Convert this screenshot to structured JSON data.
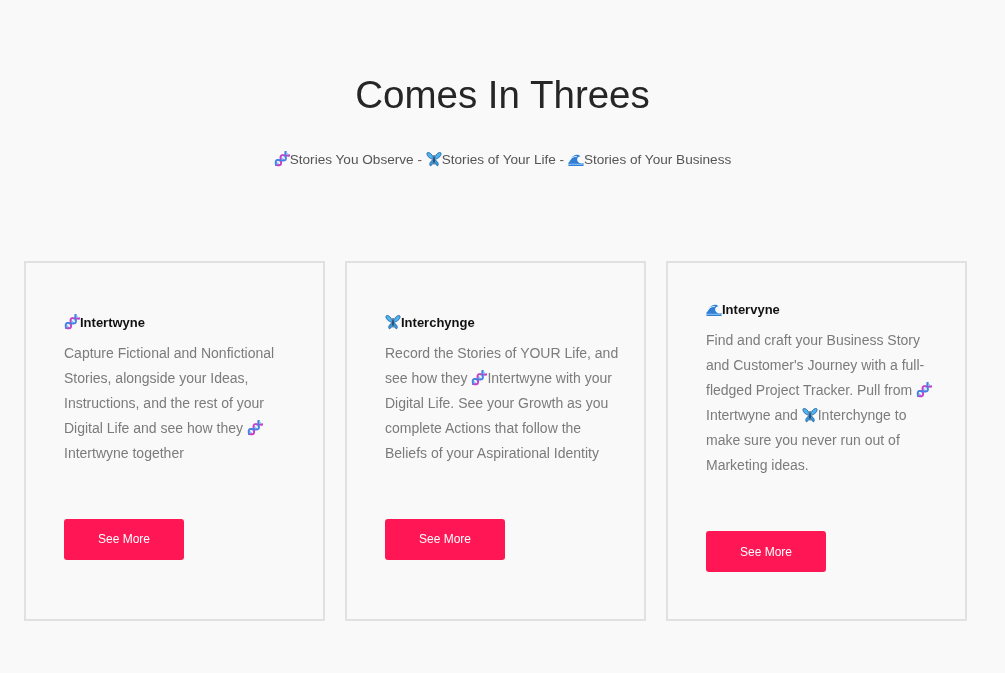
{
  "section": {
    "title": "Comes In Threes",
    "tagline": [
      {
        "kind": "dna"
      },
      {
        "kind": "text",
        "text": "Stories You Observe -"
      },
      {
        "kind": "butterfly"
      },
      {
        "kind": "text",
        "text": "Stories of Your Life -"
      },
      {
        "kind": "wave"
      },
      {
        "kind": "text",
        "text": "Stories of Your Business"
      }
    ]
  },
  "cards": [
    {
      "heading": [
        {
          "kind": "dna"
        },
        {
          "kind": "text",
          "text": "Intertwyne"
        }
      ],
      "description": [
        {
          "kind": "text",
          "text": "Capture Fictional and Nonfictional Stories, alongside your Ideas, Instructions, and the rest of your Digital Life and see how they"
        },
        {
          "kind": "dna"
        },
        {
          "kind": "text",
          "text": "Intertwyne together"
        }
      ],
      "button": "See More"
    },
    {
      "heading": [
        {
          "kind": "butterfly"
        },
        {
          "kind": "text",
          "text": "Interchynge"
        }
      ],
      "description": [
        {
          "kind": "text",
          "text": "Record the Stories of YOUR Life, and see how they"
        },
        {
          "kind": "dna"
        },
        {
          "kind": "text",
          "text": "Intertwyne with your Digital Life. See your Growth as you complete Actions that follow the Beliefs of your Aspirational Identity"
        }
      ],
      "button": "See More"
    },
    {
      "heading": [
        {
          "kind": "wave"
        },
        {
          "kind": "text",
          "text": "Intervyne"
        }
      ],
      "description": [
        {
          "kind": "text",
          "text": "Find and craft your Business Story and Customer's Journey with a full-fledged Project Tracker. Pull from"
        },
        {
          "kind": "dna"
        },
        {
          "kind": "text",
          "text": "Intertwyne and"
        },
        {
          "kind": "butterfly"
        },
        {
          "kind": "text",
          "text": "Interchynge to make sure you never run out of Marketing ideas."
        }
      ],
      "button": "See More"
    }
  ]
}
